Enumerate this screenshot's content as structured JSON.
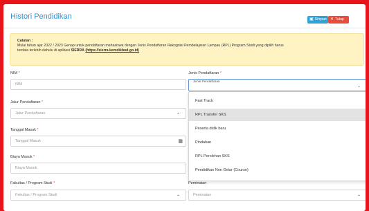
{
  "header": {
    "title": "Histori Pendidikan",
    "save_label": "Simpan",
    "close_label": "Tutup"
  },
  "note": {
    "heading": "Catatan :",
    "line1": "Mulai tahun ajar 2022 / 2023 Genap untuk pendaftaran mahasiswa dengan Jenis Pendaftaran Rekognisi Pembelajaran Lampau (RPL) Program Studi yang dipilih harus",
    "line2_prefix": "terdata terlebih dahulu di aplikasi",
    "line2_app": "SIERRA",
    "line2_link": "(https://sierra.kemdikbud.go.id)"
  },
  "form": {
    "nim": {
      "label": "NIM",
      "placeholder": "NIM"
    },
    "jenis_pendaftaran": {
      "label": "Jenis Pendaftaran",
      "value": "Jenis Pendaftaran"
    },
    "jalur_pendaftaran": {
      "label": "Jalur Pendaftaran",
      "placeholder": "Jalur Pendaftaran"
    },
    "tanggal_masuk": {
      "label": "Tanggal Masuk",
      "placeholder": "Tanggal Masuk"
    },
    "biaya_masuk": {
      "label": "Biaya Masuk",
      "placeholder": "Biaya Masuk"
    },
    "fakultas_prodi": {
      "label": "Fakultas / Program Studi",
      "placeholder": "Fakultas / Program Studi"
    },
    "peminatan": {
      "label": "Peminatan",
      "placeholder": "Peminatan"
    },
    "required_mark": "*"
  },
  "dropdown": {
    "options": [
      "Fast Track",
      "RPL Transfer SKS",
      "Peserta didik baru",
      "Pindahan",
      "RPL Perolehan SKS",
      "Pendidikan Non Gelar (Course)"
    ],
    "highlighted_index": 1
  },
  "icons": {
    "save": "save-icon",
    "close": "close-icon",
    "chevron": "chevron-down-icon",
    "calendar": "calendar-icon"
  },
  "colors": {
    "frame": "#e8141b",
    "title": "#2f8ecb",
    "save_btn": "#2fa3d6",
    "close_btn": "#e74c3c",
    "note_bg": "#fff3c4"
  }
}
